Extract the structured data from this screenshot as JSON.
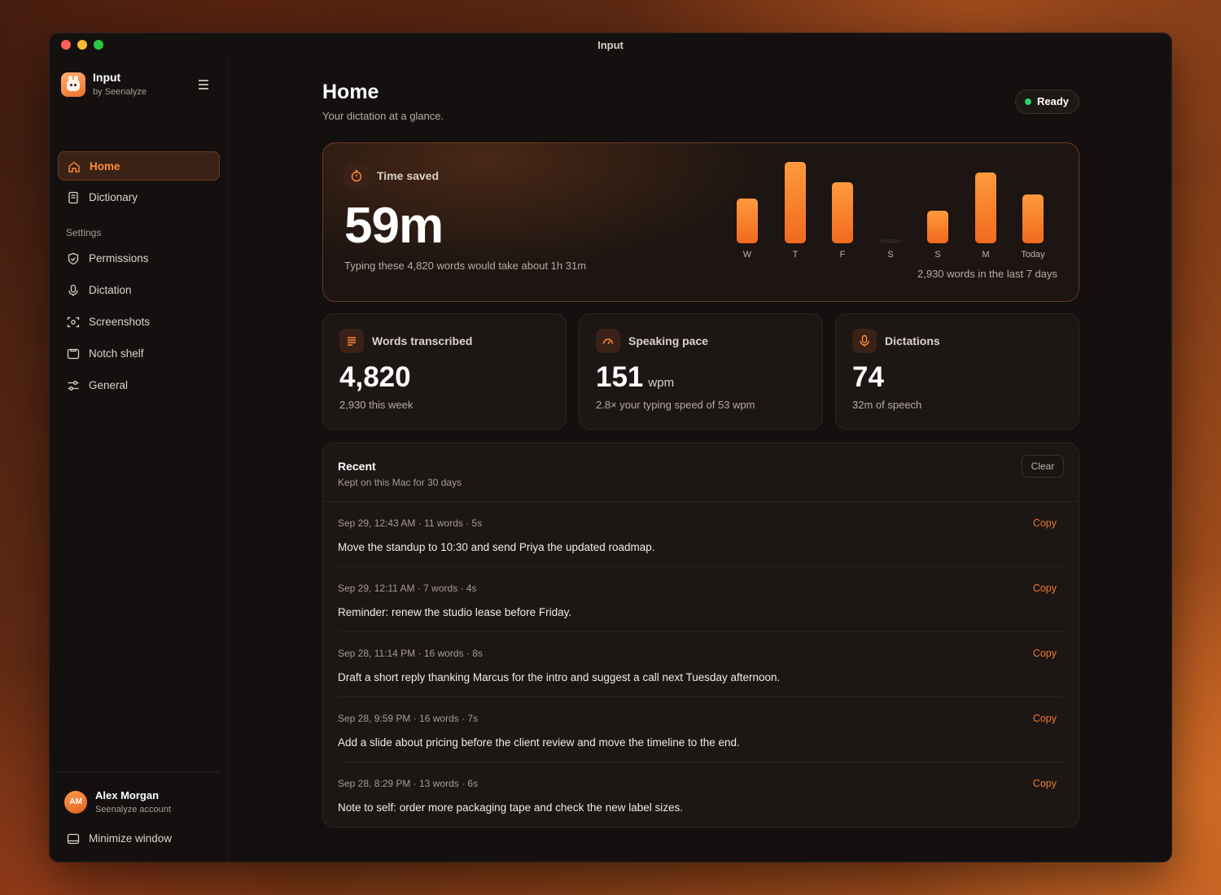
{
  "window": {
    "title": "Input"
  },
  "brand": {
    "name": "Input",
    "subtitle": "by Seenalyze"
  },
  "sidebar": {
    "items": [
      {
        "label": "Home",
        "icon": "home-icon",
        "active": true
      },
      {
        "label": "Dictionary",
        "icon": "book-icon",
        "active": false
      }
    ],
    "section_label": "Settings",
    "settings_items": [
      {
        "label": "Permissions",
        "icon": "shield-icon"
      },
      {
        "label": "Dictation",
        "icon": "microphone-icon"
      },
      {
        "label": "Screenshots",
        "icon": "screenshot-icon"
      },
      {
        "label": "Notch shelf",
        "icon": "shelf-icon"
      },
      {
        "label": "General",
        "icon": "sliders-icon"
      }
    ],
    "user": {
      "initials": "AM",
      "name": "Alex Morgan",
      "account": "Seenalyze account"
    },
    "minimize_label": "Minimize window"
  },
  "header": {
    "title": "Home",
    "subtitle": "Your dictation at a glance.",
    "status": "Ready",
    "status_color": "#2fd26a"
  },
  "hero": {
    "label": "Time saved",
    "value": "59m",
    "note": "Typing these 4,820 words would take about 1h 31m",
    "caption": "2,930 words in the last 7 days"
  },
  "chart_data": {
    "type": "bar",
    "categories": [
      "W",
      "T",
      "F",
      "S",
      "S",
      "M",
      "Today"
    ],
    "values": [
      0.55,
      1.0,
      0.75,
      0.0,
      0.4,
      0.87,
      0.6
    ],
    "accent_color": "#f07a2a"
  },
  "stats": [
    {
      "label": "Words transcribed",
      "value": "4,820",
      "unit": "",
      "note": "2,930 this week",
      "icon": "lines-icon"
    },
    {
      "label": "Speaking pace",
      "value": "151",
      "unit": "wpm",
      "note": "2.8× your typing speed of 53 wpm",
      "icon": "gauge-icon"
    },
    {
      "label": "Dictations",
      "value": "74",
      "unit": "",
      "note": "32m of speech",
      "icon": "microphone-icon"
    }
  ],
  "recent": {
    "title": "Recent",
    "subtitle": "Kept on this Mac for 30 days",
    "clear_label": "Clear",
    "copy_label": "Copy",
    "items": [
      {
        "meta": "Sep 29, 12:43 AM · 11 words · 5s",
        "text": "Move the standup to 10:30 and send Priya the updated roadmap."
      },
      {
        "meta": "Sep 29, 12:11 AM · 7 words · 4s",
        "text": "Reminder: renew the studio lease before Friday."
      },
      {
        "meta": "Sep 28, 11:14 PM · 16 words · 8s",
        "text": "Draft a short reply thanking Marcus for the intro and suggest a call next Tuesday afternoon."
      },
      {
        "meta": "Sep 28, 9:59 PM · 16 words · 7s",
        "text": "Add a slide about pricing before the client review and move the timeline to the end."
      },
      {
        "meta": "Sep 28, 8:29 PM · 13 words · 6s",
        "text": "Note to self: order more packaging tape and check the new label sizes."
      }
    ]
  }
}
